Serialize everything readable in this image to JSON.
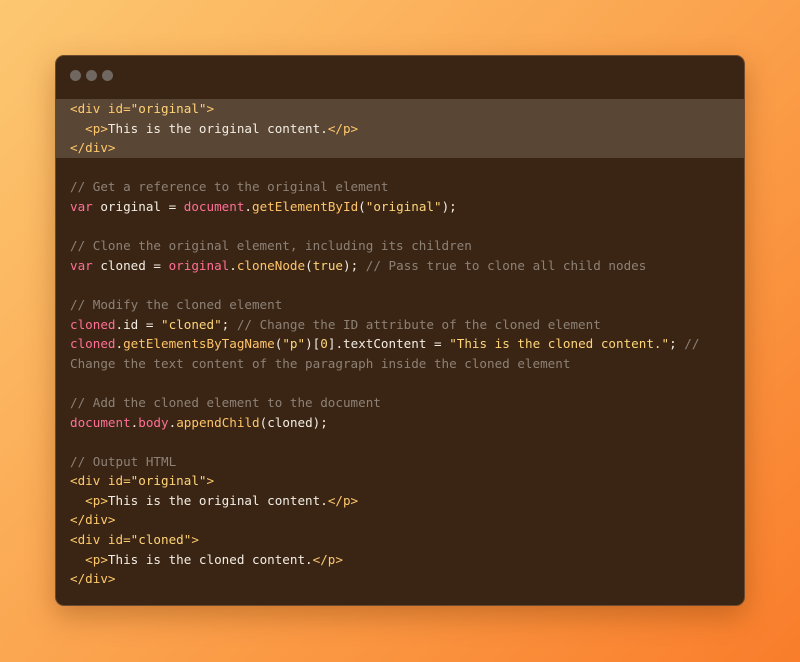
{
  "window": {
    "controls": [
      "close-dot",
      "minimize-dot",
      "maximize-dot"
    ],
    "control_color": "#6f6760"
  },
  "code_lines": [
    {
      "hl": true,
      "tokens": [
        [
          "tag",
          "<div id="
        ],
        [
          "str",
          "\"original\""
        ],
        [
          "tag",
          ">"
        ]
      ]
    },
    {
      "hl": true,
      "tokens": [
        [
          "pl",
          "  "
        ],
        [
          "tag",
          "<p>"
        ],
        [
          "pl",
          "This is the original content."
        ],
        [
          "tag",
          "</p>"
        ]
      ]
    },
    {
      "hl": true,
      "tokens": [
        [
          "tag",
          "</div>"
        ]
      ]
    },
    {
      "hl": false,
      "tokens": []
    },
    {
      "hl": false,
      "tokens": [
        [
          "cmt",
          "// Get a reference to the original element"
        ]
      ]
    },
    {
      "hl": false,
      "tokens": [
        [
          "kw",
          "var"
        ],
        [
          "pl",
          " original = "
        ],
        [
          "obj",
          "document"
        ],
        [
          "pl",
          "."
        ],
        [
          "fn",
          "getElementById"
        ],
        [
          "pl",
          "("
        ],
        [
          "str",
          "\"original\""
        ],
        [
          "pl",
          ");"
        ]
      ]
    },
    {
      "hl": false,
      "tokens": []
    },
    {
      "hl": false,
      "tokens": [
        [
          "cmt",
          "// Clone the original element, including its children"
        ]
      ]
    },
    {
      "hl": false,
      "tokens": [
        [
          "kw",
          "var"
        ],
        [
          "pl",
          " cloned = "
        ],
        [
          "obj",
          "original"
        ],
        [
          "pl",
          "."
        ],
        [
          "fn",
          "cloneNode"
        ],
        [
          "pl",
          "("
        ],
        [
          "str",
          "true"
        ],
        [
          "pl",
          "); "
        ],
        [
          "cmt",
          "// Pass true to clone all child nodes"
        ]
      ]
    },
    {
      "hl": false,
      "tokens": []
    },
    {
      "hl": false,
      "tokens": [
        [
          "cmt",
          "// Modify the cloned element"
        ]
      ]
    },
    {
      "hl": false,
      "tokens": [
        [
          "obj",
          "cloned"
        ],
        [
          "pl",
          ".id = "
        ],
        [
          "str",
          "\"cloned\""
        ],
        [
          "pl",
          "; "
        ],
        [
          "cmt",
          "// Change the ID attribute of the cloned element"
        ]
      ]
    },
    {
      "hl": false,
      "tokens": [
        [
          "obj",
          "cloned"
        ],
        [
          "pl",
          "."
        ],
        [
          "fn",
          "getElementsByTagName"
        ],
        [
          "pl",
          "("
        ],
        [
          "str",
          "\"p\""
        ],
        [
          "pl",
          ")["
        ],
        [
          "str",
          "0"
        ],
        [
          "pl",
          "].textContent = "
        ],
        [
          "str",
          "\"This is the cloned content.\""
        ],
        [
          "pl",
          "; "
        ],
        [
          "cmt",
          "//"
        ]
      ]
    },
    {
      "hl": false,
      "tokens": [
        [
          "cmt",
          "Change the text content of the paragraph inside the cloned element"
        ]
      ]
    },
    {
      "hl": false,
      "tokens": []
    },
    {
      "hl": false,
      "tokens": [
        [
          "cmt",
          "// Add the cloned element to the document"
        ]
      ]
    },
    {
      "hl": false,
      "tokens": [
        [
          "obj",
          "document"
        ],
        [
          "pl",
          "."
        ],
        [
          "obj",
          "body"
        ],
        [
          "pl",
          "."
        ],
        [
          "fn",
          "appendChild"
        ],
        [
          "pl",
          "(cloned);"
        ]
      ]
    },
    {
      "hl": false,
      "tokens": []
    },
    {
      "hl": false,
      "tokens": [
        [
          "cmt",
          "// Output HTML"
        ]
      ]
    },
    {
      "hl": false,
      "tokens": [
        [
          "tag",
          "<div id="
        ],
        [
          "str",
          "\"original\""
        ],
        [
          "tag",
          ">"
        ]
      ]
    },
    {
      "hl": false,
      "tokens": [
        [
          "pl",
          "  "
        ],
        [
          "tag",
          "<p>"
        ],
        [
          "pl",
          "This is the original content."
        ],
        [
          "tag",
          "</p>"
        ]
      ]
    },
    {
      "hl": false,
      "tokens": [
        [
          "tag",
          "</div>"
        ]
      ]
    },
    {
      "hl": false,
      "tokens": [
        [
          "tag",
          "<div id="
        ],
        [
          "str",
          "\"cloned\""
        ],
        [
          "tag",
          ">"
        ]
      ]
    },
    {
      "hl": false,
      "tokens": [
        [
          "pl",
          "  "
        ],
        [
          "tag",
          "<p>"
        ],
        [
          "pl",
          "This is the cloned content."
        ],
        [
          "tag",
          "</p>"
        ]
      ]
    },
    {
      "hl": false,
      "tokens": [
        [
          "tag",
          "</div>"
        ]
      ]
    }
  ]
}
